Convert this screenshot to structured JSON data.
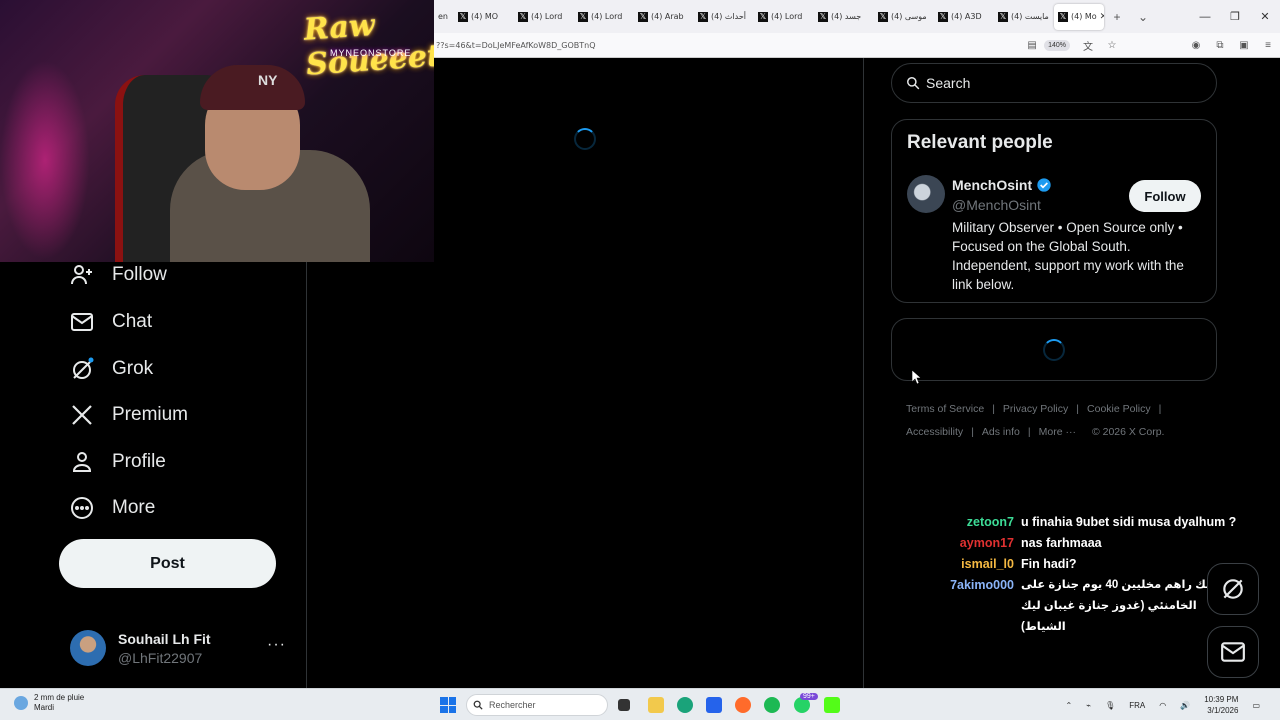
{
  "browser": {
    "tabs": [
      {
        "label": "(4) MO"
      },
      {
        "label": "(4) Lord"
      },
      {
        "label": "(4) Lord"
      },
      {
        "label": "(4) Arab"
      },
      {
        "label": "(4) أحداث"
      },
      {
        "label": "(4) Lord"
      },
      {
        "label": "(4) جسد"
      },
      {
        "label": "(4) موسى"
      },
      {
        "label": "(4) A3D"
      },
      {
        "label": "(4) مايست"
      },
      {
        "label": "(4) Mo"
      }
    ],
    "leading_tab_fragment": "en",
    "url": "??s=46&t=DoLJeMFeAfKoW8D_GOBTnQ",
    "zoom": "140%"
  },
  "stream": {
    "logo_text": "Raw Soueeet",
    "logo_sub": "MYNEONSTORE"
  },
  "sidebar": {
    "items": [
      {
        "label": "Follow"
      },
      {
        "label": "Chat"
      },
      {
        "label": "Grok"
      },
      {
        "label": "Premium"
      },
      {
        "label": "Profile"
      },
      {
        "label": "More"
      }
    ],
    "post_label": "Post",
    "account": {
      "name": "Souhail Lh Fit",
      "handle": "@LhFit22907",
      "more": "···"
    }
  },
  "right": {
    "search_placeholder": "Search",
    "relevant": {
      "title": "Relevant people",
      "name": "MenchOsint",
      "handle": "@MenchOsint",
      "follow_label": "Follow",
      "bio": "Military Observer • Open Source only • Focused on the Global South. Independent, support my work with the link below."
    },
    "footer": {
      "terms": "Terms of Service",
      "privacy": "Privacy Policy",
      "cookie": "Cookie Policy",
      "accessibility": "Accessibility",
      "ads": "Ads info",
      "more": "More ···",
      "copyright": "© 2026 X Corp."
    }
  },
  "chat": [
    {
      "user": "zetoon7",
      "color": "#3ddc97",
      "msg": "u finahia 9ubet sidi musa dyalhum ?"
    },
    {
      "user": "aymon17",
      "color": "#e03131",
      "msg": "nas farhmaaa"
    },
    {
      "user": "ismail_l0",
      "color": "#f5b942",
      "msg": "Fin hadi?"
    },
    {
      "user": "7akimo000",
      "color": "#8ab4f8",
      "msg": "كاليك راهم مخليين 40 يوم جنازة على الخامنئي (غدوز جنازة غيبان ليك الشياط)"
    }
  ],
  "taskbar": {
    "weather_line1": "2 mm de pluie",
    "weather_line2": "Mardi",
    "search_label": "Rechercher",
    "badge": "99+",
    "lang": "FRA",
    "time": "10:39 PM",
    "date": "3/1/2026"
  },
  "colors": {
    "accent": "#1d9bf0",
    "border": "#2f3336",
    "muted": "#71767b"
  }
}
